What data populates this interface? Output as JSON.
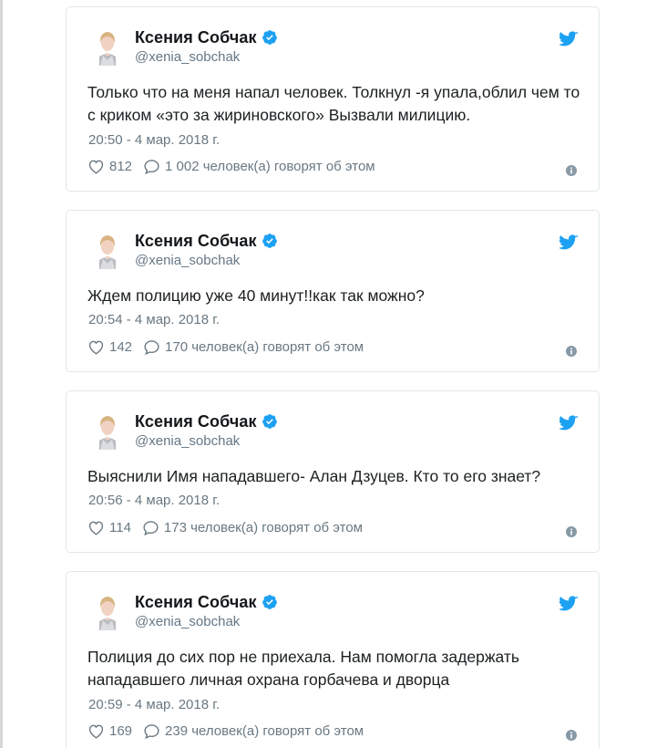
{
  "tweets": [
    {
      "author": "Ксения Собчак",
      "handle": "@xenia_sobchak",
      "text": "Только что на меня напал человек. Толкнул -я упала,облил чем то с криком «это за жириновского» Вызвали милицию.",
      "timestamp": "20:50 - 4 мар. 2018 г.",
      "likes": "812",
      "replies": "1 002 человек(а) говорят об этом"
    },
    {
      "author": "Ксения Собчак",
      "handle": "@xenia_sobchak",
      "text": "Ждем полицию уже 40 минут!!как так можно?",
      "timestamp": "20:54 - 4 мар. 2018 г.",
      "likes": "142",
      "replies": "170 человек(а) говорят об этом"
    },
    {
      "author": "Ксения Собчак",
      "handle": "@xenia_sobchak",
      "text": "Выяснили Имя нападавшего- Алан Дзуцев. Кто то его знает?",
      "timestamp": "20:56 - 4 мар. 2018 г.",
      "likes": "114",
      "replies": "173 человек(а) говорят об этом"
    },
    {
      "author": "Ксения Собчак",
      "handle": "@xenia_sobchak",
      "text": "Полиция до сих пор не приехала. Нам помогла задержать нападавшего личная охрана горбачева и дворца",
      "timestamp": "20:59 - 4 мар. 2018 г.",
      "likes": "169",
      "replies": "239 человек(а) говорят об этом"
    }
  ],
  "icons": {
    "verified": "verified-badge-icon",
    "bird": "twitter-bird-icon",
    "heart": "heart-icon",
    "reply": "speech-bubble-icon",
    "info": "info-icon"
  },
  "colors": {
    "twitter_blue": "#1da1f2",
    "meta_gray": "#697882",
    "text": "#1c2022"
  }
}
